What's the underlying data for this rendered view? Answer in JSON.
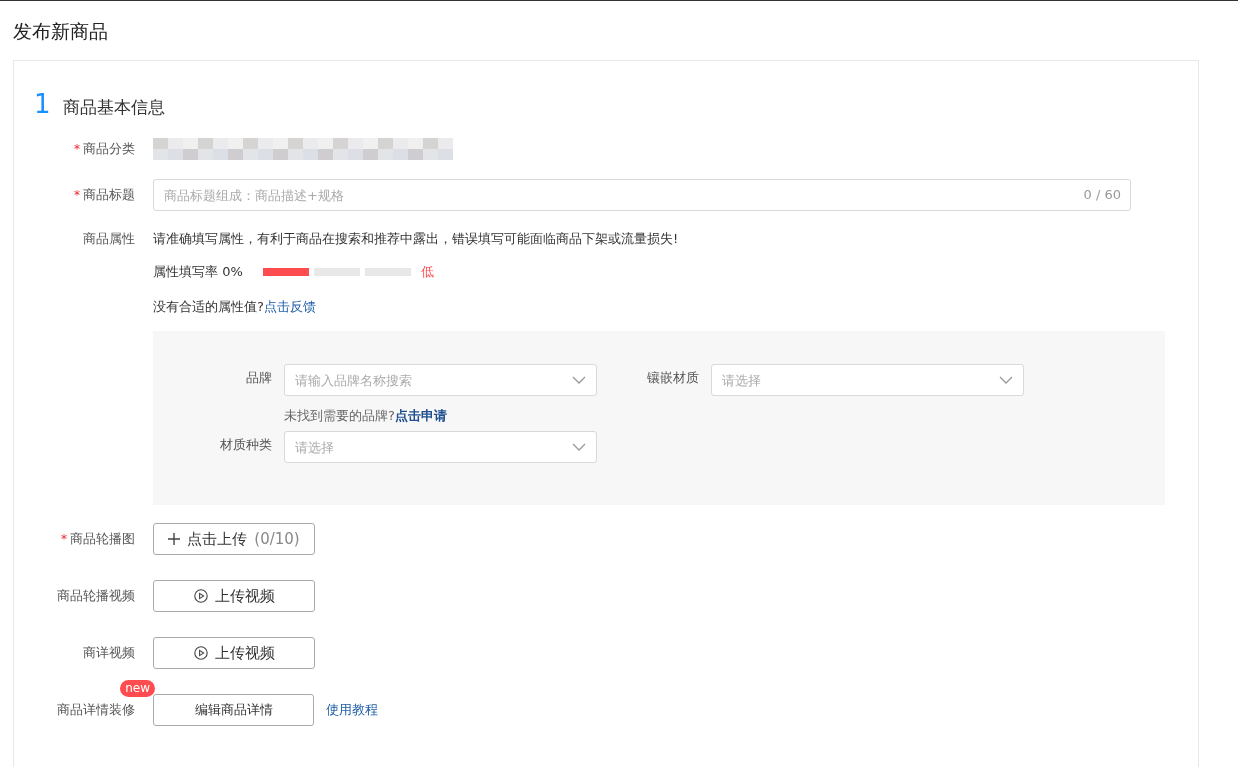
{
  "page_title": "发布新商品",
  "section": {
    "number": "1",
    "title": "商品基本信息"
  },
  "fields": [
    {
      "kind": "category",
      "label": "商品分类",
      "mark": "*"
    },
    {
      "kind": "input",
      "label": "商品标题",
      "mark": "*",
      "placeholder": "商品标题组成：商品描述+规格",
      "counter": "0 / 60"
    },
    {
      "kind": "attributes",
      "label": "商品属性",
      "notice": "请准确填写属性，有利于商品在搜索和推荐中露出，错误填写可能面临商品下架或流量损失!",
      "rate_label": "属性填写率 0%",
      "segments": [
        {
          "filled": true
        },
        {
          "filled": false
        },
        {
          "filled": false
        }
      ],
      "rate_text": "低",
      "feedback_text": "没有合适的属性值?",
      "feedback_link": "点击反馈",
      "attributes": [
        {
          "label": "品牌",
          "placeholder": "请输入品牌名称搜索",
          "hint": "未找到需要的品牌?",
          "hint_link": "点击申请"
        },
        {
          "label": "镶嵌材质",
          "placeholder": "请选择"
        },
        {
          "label": "材质种类",
          "placeholder": "请选择"
        }
      ]
    },
    {
      "kind": "upload_image",
      "label": "商品轮播图",
      "mark": "*",
      "text": "点击上传",
      "count": "(0/10)"
    },
    {
      "kind": "upload_video",
      "label": "商品轮播视频",
      "text": "上传视频"
    },
    {
      "kind": "upload_video",
      "label": "商详视频",
      "text": "上传视频"
    },
    {
      "kind": "edit",
      "label": "商品详情装修",
      "badge": "new",
      "text": "编辑商品详情",
      "link": "使用教程"
    }
  ]
}
